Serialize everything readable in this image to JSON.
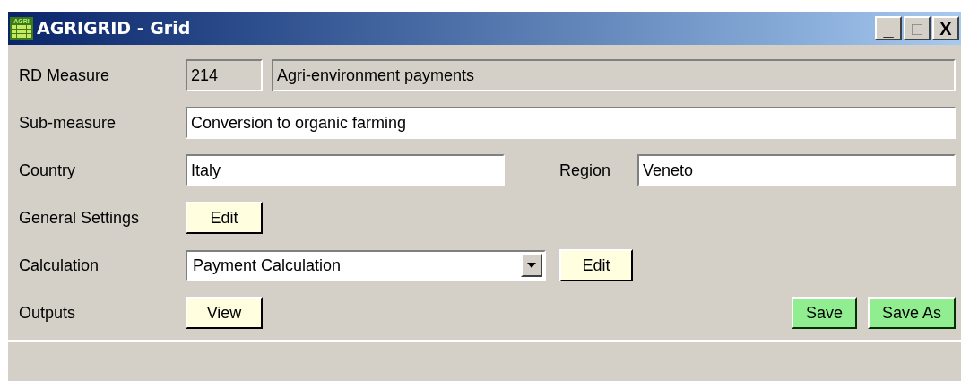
{
  "window": {
    "logo_text": "AGRI",
    "title": "AGRIGRID - Grid",
    "controls": [
      "_",
      "□",
      "X"
    ]
  },
  "rd_measure": {
    "label": "RD Measure",
    "code": "214",
    "name": "Agri-environment payments",
    "disabled": true
  },
  "sub_measure": {
    "label": "Sub-measure",
    "value": "Conversion to organic farming"
  },
  "country": {
    "label": "Country",
    "value": "Italy"
  },
  "region": {
    "label": "Region",
    "value": "Veneto"
  },
  "general_settings": {
    "label": "General Settings",
    "button": "Edit"
  },
  "calculation": {
    "label": "Calculation",
    "value": "Payment Calculation",
    "button": "Edit"
  },
  "outputs": {
    "label": "Outputs",
    "button": "View"
  },
  "actions": [
    "Save",
    "Save As"
  ]
}
